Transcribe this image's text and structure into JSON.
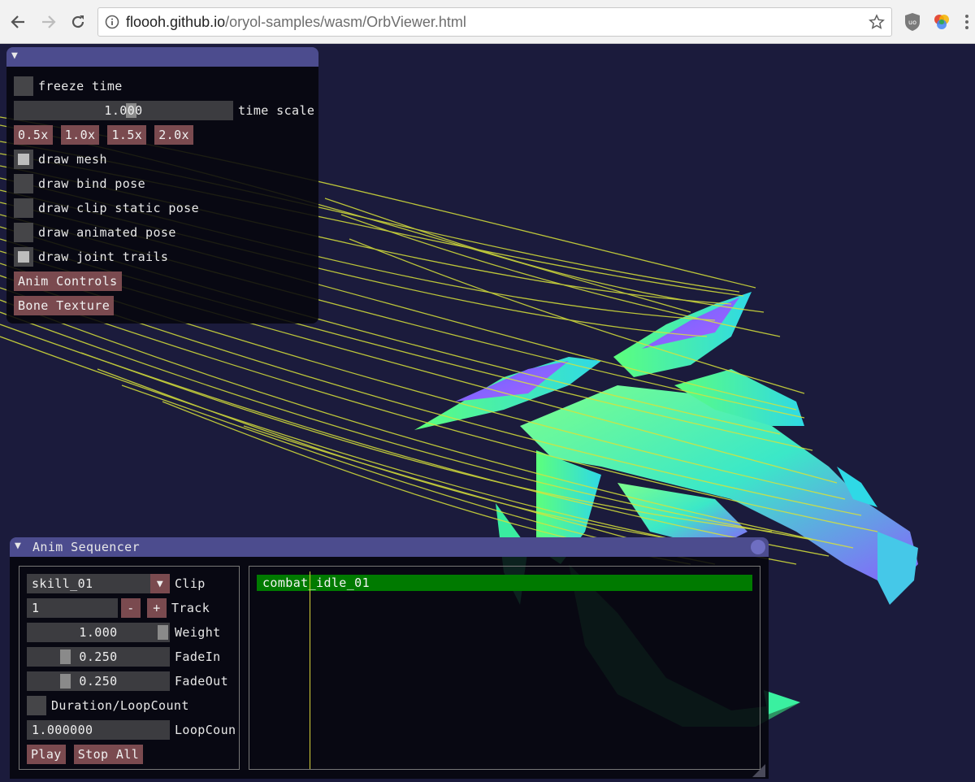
{
  "browser": {
    "url_host": "floooh.github.io",
    "url_path": "/oryol-samples/wasm/OrbViewer.html",
    "icons": [
      "back-arrow-icon",
      "forward-arrow-icon",
      "reload-icon",
      "info-icon",
      "star-icon",
      "ublock-shield-icon",
      "extension-colorful-icon",
      "kebab-menu-icon"
    ]
  },
  "main_panel": {
    "collapse_arrow": "▼",
    "freeze_time": {
      "label": "freeze time",
      "checked": false
    },
    "time_scale": {
      "value": "1.000",
      "label": "time scale"
    },
    "speed_buttons": [
      "0.5x",
      "1.0x",
      "1.5x",
      "2.0x"
    ],
    "toggles": [
      {
        "label": "draw mesh",
        "checked": true
      },
      {
        "label": "draw bind pose",
        "checked": false
      },
      {
        "label": "draw clip static pose",
        "checked": false
      },
      {
        "label": "draw animated pose",
        "checked": false
      },
      {
        "label": "draw joint trails",
        "checked": true
      }
    ],
    "anim_controls_label": "Anim Controls",
    "bone_texture_label": "Bone Texture"
  },
  "sequencer": {
    "title": "Anim Sequencer",
    "collapse_arrow": "▼",
    "clip": {
      "value": "skill_01",
      "label": "Clip",
      "arrow": "▼"
    },
    "track": {
      "value": "1",
      "label": "Track",
      "minus": "-",
      "plus": "+"
    },
    "weight": {
      "value": "1.000",
      "label": "Weight"
    },
    "fade_in": {
      "value": "0.250",
      "label": "FadeIn"
    },
    "fade_out": {
      "value": "0.250",
      "label": "FadeOut"
    },
    "duration_loopcount": {
      "label": "Duration/LoopCount",
      "checked": false
    },
    "loop_count": {
      "value": "1.000000",
      "label": "LoopCoun"
    },
    "play_label": "Play",
    "stop_all_label": "Stop All",
    "timeline_clip": "combat_idle_01"
  },
  "colors": {
    "scene_bg": "#1b1b3c",
    "title_bar": "#4c4c8e",
    "button": "#7a4a4f",
    "timeline_clip": "#007a00",
    "trail": "#d8e23a"
  }
}
